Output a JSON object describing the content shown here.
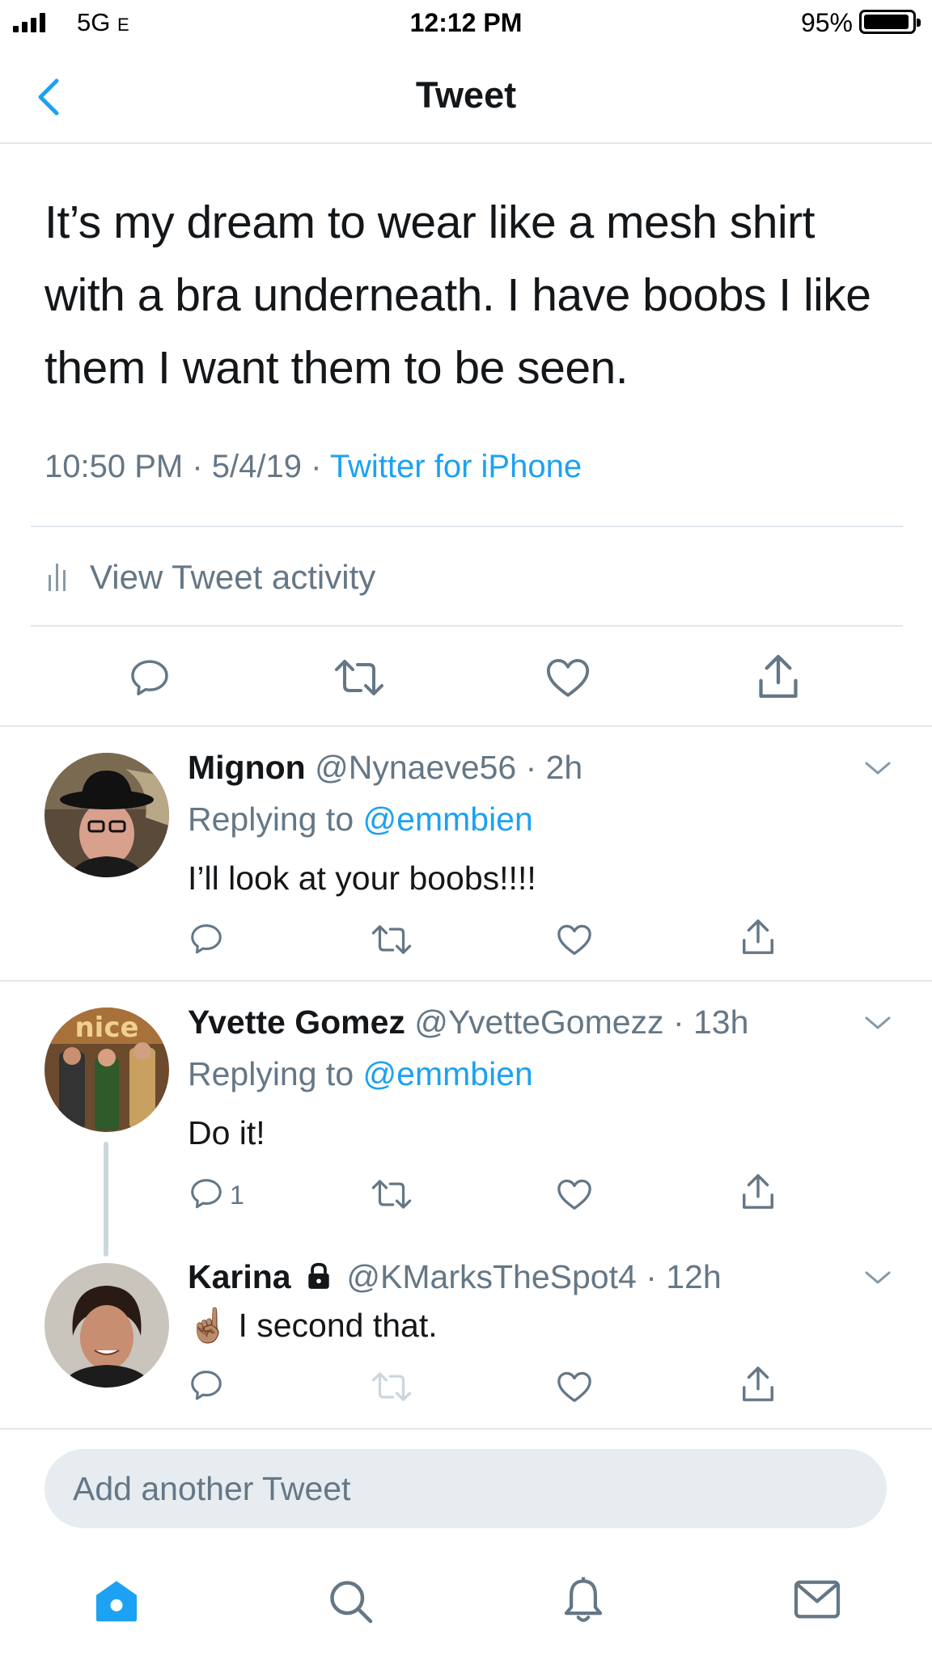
{
  "status_bar": {
    "network": "5G",
    "network_suffix": "E",
    "time": "12:12 PM",
    "battery_percent": "95%",
    "battery_level": 0.95
  },
  "nav": {
    "title": "Tweet",
    "back_icon": "chevron-left-icon"
  },
  "tweet": {
    "text": "It’s my dream to wear like a mesh shirt with a bra underneath. I have boobs I like them I want them to be seen.",
    "time": "10:50 PM",
    "date": "5/4/19",
    "source": "Twitter for iPhone",
    "activity_label": "View Tweet activity"
  },
  "replies": [
    {
      "name": "Mignon",
      "handle": "@Nynaeve56",
      "age": "2h",
      "replying_prefix": "Replying to",
      "replying_to": "@emmbien",
      "text": "I’ll look at your boobs!!!!",
      "reply_count": ""
    },
    {
      "name": "Yvette Gomez",
      "handle": "@YvetteGomezz",
      "age": "13h",
      "replying_prefix": "Replying to",
      "replying_to": "@emmbien",
      "text": "Do it!",
      "reply_count": "1",
      "avatar_text": "nice"
    },
    {
      "name": "Karina",
      "handle": "@KMarksTheSpot4",
      "age": "12h",
      "emoji": "☝🏽",
      "text": "I second that.",
      "protected": true
    }
  ],
  "compose": {
    "placeholder": "Add another Tweet"
  },
  "tabs": [
    {
      "name": "Home",
      "icon": "home-icon",
      "active": true
    },
    {
      "name": "Search",
      "icon": "search-icon",
      "active": false
    },
    {
      "name": "Notifications",
      "icon": "bell-icon",
      "active": false
    },
    {
      "name": "Messages",
      "icon": "mail-icon",
      "active": false
    }
  ],
  "colors": {
    "accent": "#1da1f2",
    "secondary_text": "#657786",
    "primary_text": "#14171a",
    "divider": "#e1e8ed",
    "compose_bg": "#e6ecf0"
  }
}
